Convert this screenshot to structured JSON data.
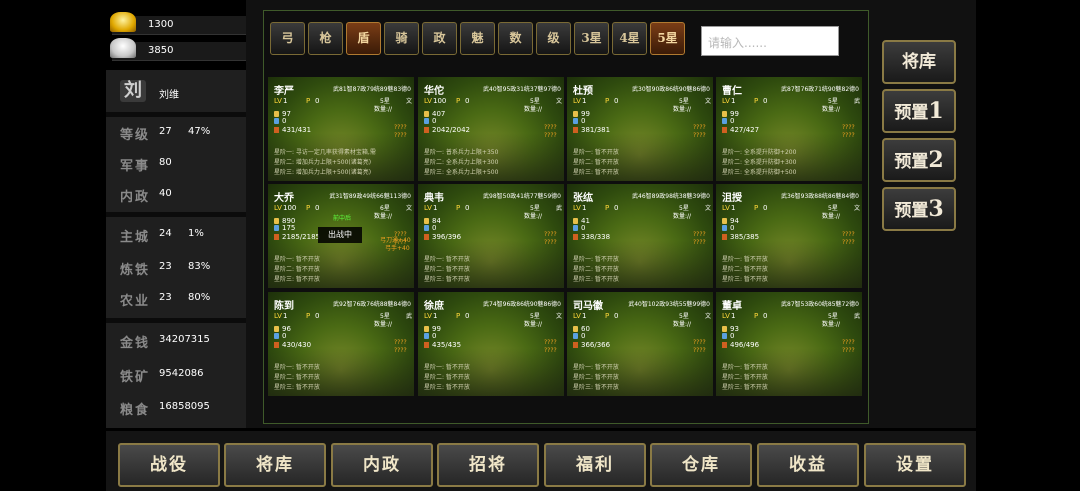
{
  "resources": {
    "gold_ingot": "1300",
    "silver_ingot": "3850"
  },
  "player": {
    "name": "刘维",
    "avatar_glyph": "刘"
  },
  "stats": [
    {
      "label": "等级",
      "value": "27",
      "extra": "47%"
    },
    {
      "label": "军事",
      "value": "80",
      "extra": ""
    },
    {
      "label": "内政",
      "value": "40",
      "extra": ""
    },
    {
      "label": "主城",
      "value": "24",
      "extra": "1%"
    },
    {
      "label": "炼铁",
      "value": "23",
      "extra": "83%"
    },
    {
      "label": "农业",
      "value": "23",
      "extra": "80%"
    }
  ],
  "treasury": [
    {
      "label": "金钱",
      "value": "34207315"
    },
    {
      "label": "铁矿",
      "value": "9542086"
    },
    {
      "label": "粮食",
      "value": "16858095"
    }
  ],
  "filter_tabs": [
    "弓",
    "枪",
    "盾",
    "骑",
    "政",
    "魅",
    "数",
    "级",
    "3星",
    "4星",
    "5星"
  ],
  "active_tab": "盾",
  "search": {
    "placeholder": "请输入......"
  },
  "general_labels": {
    "lv": "LV",
    "points": "P",
    "qty": "数量:",
    "q1": "????",
    "q2": "????"
  },
  "generals": [
    {
      "name": "李严",
      "stats": "武81智87政79统89魅83德0",
      "lv": "1",
      "points": "0",
      "star": "5星",
      "type": "文",
      "qty": "数量://",
      "v1": "97",
      "v2": "0",
      "v3": "431/431",
      "s1": "星阶一: 寻访一定几率获得素材宝箱,需",
      "s2": "星阶二: 增加兵力上限+500(诸葛亮)",
      "s3": "星阶三: 增加兵力上限+500(诸葛亮)"
    },
    {
      "name": "华佗",
      "stats": "武40智95政31统37魅97德0",
      "lv": "100",
      "points": "0",
      "star": "5星",
      "type": "文",
      "qty": "数量://",
      "v1": "407",
      "v2": "0",
      "v3": "2042/2042",
      "s1": "星阶一: 普系兵力上限+350",
      "s2": "星阶二: 全系兵力上限+300",
      "s3": "星阶三: 全系兵力上限+500"
    },
    {
      "name": "杜预",
      "stats": "武30智90政86统90魅86德0",
      "lv": "1",
      "points": "0",
      "star": "5星",
      "type": "文",
      "qty": "数量://",
      "v1": "99",
      "v2": "0",
      "v3": "381/381",
      "s1": "星阶一: 暂不开放",
      "s2": "星阶二: 暂不开放",
      "s3": "星阶三: 暂不开放"
    },
    {
      "name": "曹仁",
      "stats": "武87智76政71统90魅82德0",
      "lv": "1",
      "points": "0",
      "star": "5星",
      "type": "武",
      "qty": "数量://",
      "v1": "99",
      "v2": "0",
      "v3": "427/427",
      "s1": "星阶一: 全系提升防御+200",
      "s2": "星阶二: 全系提升防御+300",
      "s3": "星阶三: 全系提升防御+500"
    },
    {
      "name": "大乔",
      "stats": "武31智89政49统66魅113德0",
      "lv": "100",
      "points": "0",
      "star": "6星",
      "type": "文",
      "qty": "数量://",
      "v1": "890",
      "v2": "175",
      "v3": "2185/2185",
      "s1": "星阶一: 暂不开放",
      "s2": "星阶二: 暂不开放",
      "s3": "星阶三: 暂不开放",
      "badge_top": "前中后",
      "badge": "出战中",
      "bonus1": "弓刀通+40",
      "bonus2": "弓手+40"
    },
    {
      "name": "典韦",
      "stats": "武98智50政41统77魅59德0",
      "lv": "1",
      "points": "0",
      "star": "5星",
      "type": "武",
      "qty": "数量://",
      "v1": "84",
      "v2": "0",
      "v3": "396/396",
      "s1": "星阶一: 暂不开放",
      "s2": "星阶二: 暂不开放",
      "s3": "星阶三: 暂不开放"
    },
    {
      "name": "张纮",
      "stats": "武46智89政98统38魅39德0",
      "lv": "1",
      "points": "0",
      "star": "5星",
      "type": "文",
      "qty": "数量://",
      "v1": "41",
      "v2": "0",
      "v3": "338/338",
      "s1": "星阶一: 暂不开放",
      "s2": "星阶二: 暂不开放",
      "s3": "星阶三: 暂不开放"
    },
    {
      "name": "沮授",
      "stats": "武36智93政88统86魅84德0",
      "lv": "1",
      "points": "0",
      "star": "5星",
      "type": "文",
      "qty": "数量://",
      "v1": "94",
      "v2": "0",
      "v3": "385/385",
      "s1": "星阶一: 暂不开放",
      "s2": "星阶二: 暂不开放",
      "s3": "星阶三: 暂不开放"
    },
    {
      "name": "陈到",
      "stats": "武92智76政76统88魅84德0",
      "lv": "1",
      "points": "0",
      "star": "5星",
      "type": "武",
      "qty": "数量://",
      "v1": "96",
      "v2": "0",
      "v3": "430/430",
      "s1": "星阶一: 暂不开放",
      "s2": "星阶二: 暂不开放",
      "s3": "星阶三: 暂不开放"
    },
    {
      "name": "徐庶",
      "stats": "武74智96政86统90魅86德0",
      "lv": "1",
      "points": "0",
      "star": "5星",
      "type": "文",
      "qty": "数量://",
      "v1": "99",
      "v2": "0",
      "v3": "435/435",
      "s1": "星阶一: 暂不开放",
      "s2": "星阶二: 暂不开放",
      "s3": "星阶三: 暂不开放"
    },
    {
      "name": "司马徽",
      "stats": "武40智102政93统55魅99德0",
      "lv": "1",
      "points": "0",
      "star": "5星",
      "type": "文",
      "qty": "数量://",
      "v1": "60",
      "v2": "0",
      "v3": "366/366",
      "s1": "星阶一: 暂不开放",
      "s2": "星阶二: 暂不开放",
      "s3": "星阶三: 暂不开放"
    },
    {
      "name": "董卓",
      "stats": "武87智53政60统85魅72德0",
      "lv": "1",
      "points": "0",
      "star": "5星",
      "type": "武",
      "qty": "数量://",
      "v1": "93",
      "v2": "0",
      "v3": "496/496",
      "s1": "星阶一: 暂不开放",
      "s2": "星阶二: 暂不开放",
      "s3": "星阶三: 暂不开放"
    }
  ],
  "right_buttons": [
    {
      "text": "将库",
      "num": ""
    },
    {
      "text": "预置",
      "num": "1"
    },
    {
      "text": "预置",
      "num": "2"
    },
    {
      "text": "预置",
      "num": "3"
    }
  ],
  "bottom_nav": [
    "战役",
    "将库",
    "内政",
    "招将",
    "福利",
    "仓库",
    "收益",
    "设置"
  ],
  "colors": {
    "active_tab": "#7a3d16",
    "card_green": "#4a6a14",
    "button_border": "#8a7a45"
  }
}
